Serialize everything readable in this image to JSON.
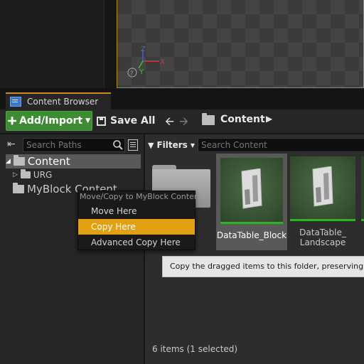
{
  "tab": {
    "title": "Content Browser"
  },
  "toolbar": {
    "add_import_label": "Add/Import",
    "save_all_label": "Save All",
    "breadcrumb": "Content"
  },
  "sources": {
    "search_placeholder": "Search Paths",
    "tree": [
      {
        "label": "Content",
        "selected": true
      },
      {
        "label": "URG"
      },
      {
        "label": "MyBlock Content"
      }
    ]
  },
  "assets": {
    "filters_label": "Filters",
    "search_placeholder": "Search Content",
    "items": [
      {
        "type": "folder",
        "label": ""
      },
      {
        "type": "DataTable",
        "label": "DataTable_Block",
        "selected": true
      },
      {
        "type": "DataTable",
        "label_line1": "DataTable_",
        "label_line2": "Landscape"
      }
    ],
    "status": "6 items (1 selected)"
  },
  "context_menu": {
    "header": "Move/Copy to MyBlock Content",
    "items": [
      "Move Here",
      "Copy Here",
      "Advanced Copy Here"
    ],
    "highlighted": "Copy Here"
  },
  "tooltip": "Copy the dragged items to this folder, preserving the st",
  "colors": {
    "accent": "#e2a013",
    "add_button": "#3d8b33",
    "asset_bar": "#3fa638",
    "tab_highlight": "#d08a1c"
  }
}
